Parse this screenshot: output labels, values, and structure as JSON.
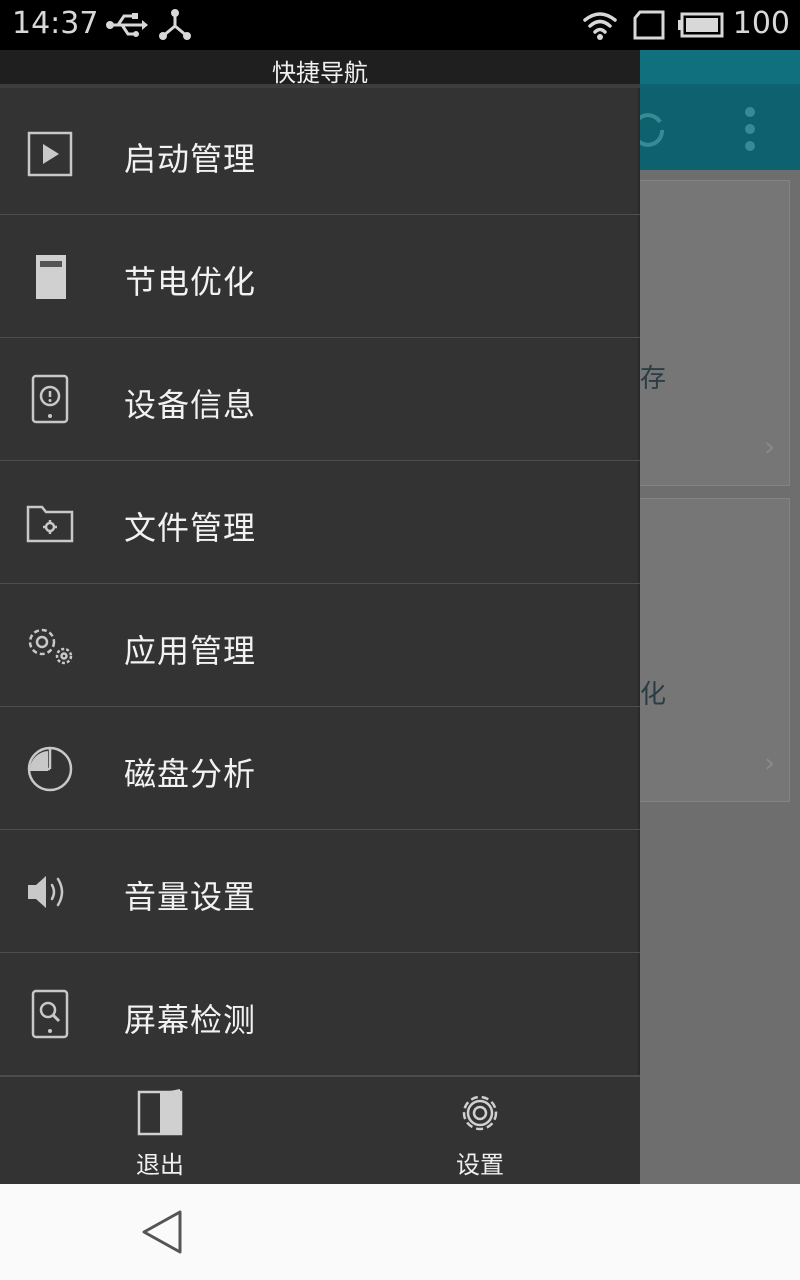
{
  "status_bar": {
    "time": "14:37",
    "battery": "100",
    "icons": [
      "usb-icon",
      "debug-icon",
      "wifi-icon",
      "sim-icon",
      "battery-icon"
    ]
  },
  "background_app": {
    "card1_text": "存",
    "card2_text": "化",
    "accent_color": "#0e6270"
  },
  "drawer": {
    "title": "快捷导航",
    "items": [
      {
        "label": "启动管理",
        "icon": "play-icon"
      },
      {
        "label": "节电优化",
        "icon": "battery-icon"
      },
      {
        "label": "设备信息",
        "icon": "device-info-icon"
      },
      {
        "label": "文件管理",
        "icon": "folder-icon"
      },
      {
        "label": "应用管理",
        "icon": "gears-icon"
      },
      {
        "label": "磁盘分析",
        "icon": "pie-chart-icon"
      },
      {
        "label": "音量设置",
        "icon": "speaker-icon"
      },
      {
        "label": "屏幕检测",
        "icon": "screen-search-icon"
      }
    ],
    "footer": {
      "exit_label": "退出",
      "settings_label": "设置"
    }
  }
}
